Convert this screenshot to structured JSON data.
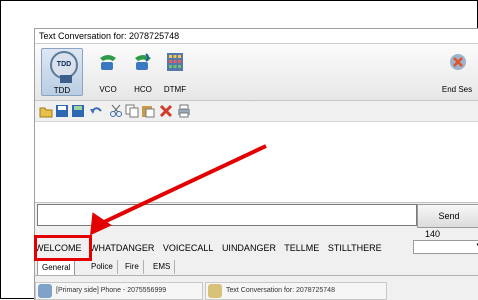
{
  "window": {
    "title": "Text Conversation for: 2078725748"
  },
  "ribbon": {
    "buttons": [
      {
        "label": "TDD",
        "icon": "tdd-phone-icon"
      },
      {
        "label": "VCO",
        "icon": "vco-phone-icon"
      },
      {
        "label": "HCO",
        "icon": "hco-phone-icon"
      },
      {
        "label": "DTMF",
        "icon": "dtmf-keypad-icon"
      }
    ],
    "end_session_label": "End Ses"
  },
  "toolbar": {
    "icons": [
      "open-folder-icon",
      "save-icon",
      "save-as-icon",
      "undo-icon",
      "cut-icon",
      "copy-icon",
      "paste-icon",
      "delete-icon",
      "print-icon"
    ]
  },
  "compose": {
    "input_value": "",
    "send_label": "Send",
    "char_counter": "140"
  },
  "quick_phrases": [
    "WELCOME",
    "WHATDANGER",
    "VOICECALL",
    "UINDANGER",
    "TELLME",
    "STILLTHERE"
  ],
  "tabs": [
    "General",
    "Police",
    "Fire",
    "EMS"
  ],
  "taskbar": [
    {
      "label": "[Primary side] Phone - 2075556999"
    },
    {
      "label": "Text Conversation for: 2078725748"
    }
  ],
  "colors": {
    "highlight": "#e30000",
    "arrow": "#e30000"
  }
}
